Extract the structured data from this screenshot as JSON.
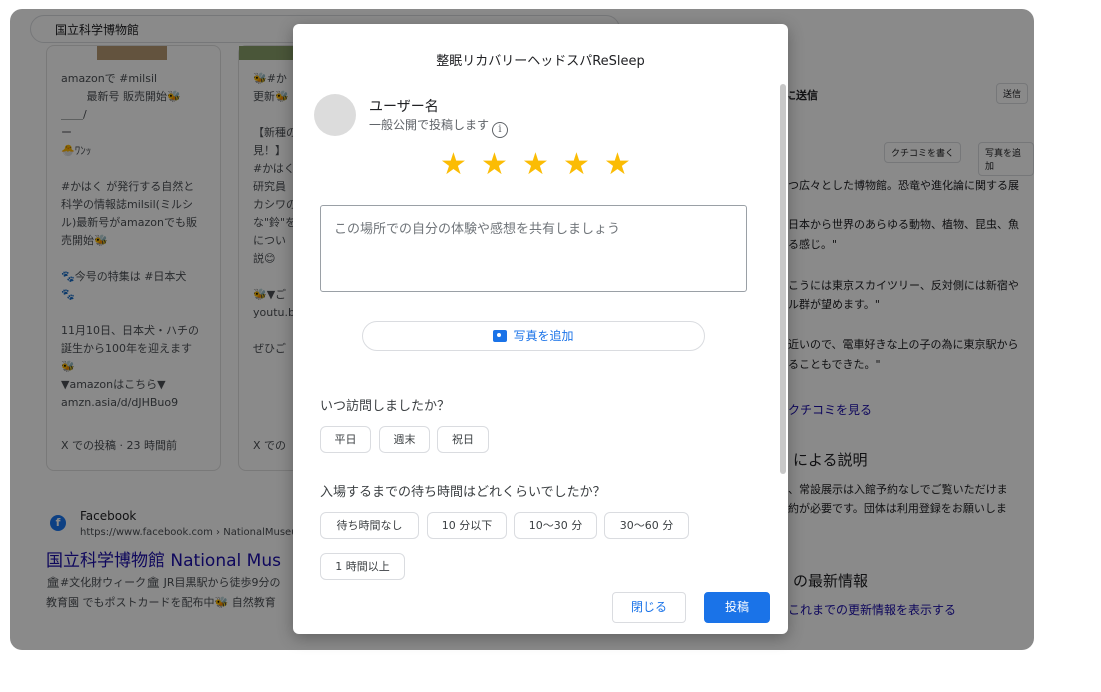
{
  "search": {
    "query": "国立科学博物館"
  },
  "background": {
    "card1": {
      "lines": [
        "amazonで #milsil",
        "　　 最新号 販売開始🐝",
        "＿＿/",
        "ー",
        "🐣ﾜﾝｯ",
        "",
        "#かはく が発行する自然と",
        "科学の情報誌milsil(ミルシ",
        "ル)最新号がamazonでも販",
        "売開始🐝",
        "",
        "🐾今号の特集は #日本犬",
        "🐾",
        "",
        "11月10日、日本犬・ハチの",
        "誕生から100年を迎えます",
        "🐝",
        "▼amazonはこちら▼",
        "amzn.asia/d/dJHBuo9"
      ],
      "footer": "X での投稿 · 23 時間前"
    },
    "card2": {
      "lines": [
        "🐝#か",
        "更新🐝",
        "",
        "【新種の",
        "見！】",
        "#かはく",
        "研究員",
        "カシワの",
        "な\"鈴\"を",
        "につい",
        "説😊",
        "",
        "🐝▼ご",
        "youtu.b",
        "",
        "ぜひご"
      ],
      "footer": "X での"
    },
    "facebook": {
      "name": "Facebook",
      "url": "https://www.facebook.com › NationalMuseumof...",
      "title": "国立科学博物館 National Mus",
      "snippet1": "🏛#文化財ウィーク🏛 JR目黒駅から徒歩9分の",
      "snippet2": "教育園 でもポストカードを配布中🐝 自然教育"
    },
    "right_panel": {
      "send_heading": "に送信",
      "send_button": "送信",
      "write_review_button": "クチコミを書く",
      "add_photo_button": "写真を追加",
      "quote1": "つ広々とした博物館。恐竜や進化論に関する展",
      "quote2a": "日本から世界のあらゆる動物、植物、昆虫、魚",
      "quote2b": "る感じ。\"",
      "quote3a": "こうには東京スカイツリー、反対側には新宿や",
      "quote3b": "ル群が望めます。\"",
      "quote4a": "近いので、電車好きな上の子の為に東京駅から",
      "quote4b": "ることもできた。\"",
      "see_reviews_link": "クチコミを見る",
      "desc_heading": "による説明",
      "desc1": "、常設展示は入館予約なしでご覧いただけま",
      "desc2": "約が必要です。団体は利用登録をお願いしま",
      "updates_heading": "の最新情報",
      "updates_link": "これまでの更新情報を表示する"
    }
  },
  "dialog": {
    "title": "整眠リカバリーヘッドスパReSleep",
    "user_name": "ユーザー名",
    "public_note": "一般公開で投稿します",
    "info_icon_glyph": "i",
    "rating": 5,
    "star_glyph": "★",
    "star_color": "#fbbc04",
    "review_placeholder": "この場所での自分の体験や感想を共有しましょう",
    "add_photo_label": "写真を追加",
    "visit_question": "いつ訪問しましたか？",
    "visit_options": [
      "平日",
      "週末",
      "祝日"
    ],
    "wait_question": "入場するまでの待ち時間はどれくらいでしたか？",
    "wait_options": [
      "待ち時間なし",
      "10 分以下",
      "10～30 分",
      "30～60 分",
      "1 時間以上"
    ],
    "close_label": "閉じる",
    "post_label": "投稿",
    "accent_color": "#1a73e8"
  }
}
